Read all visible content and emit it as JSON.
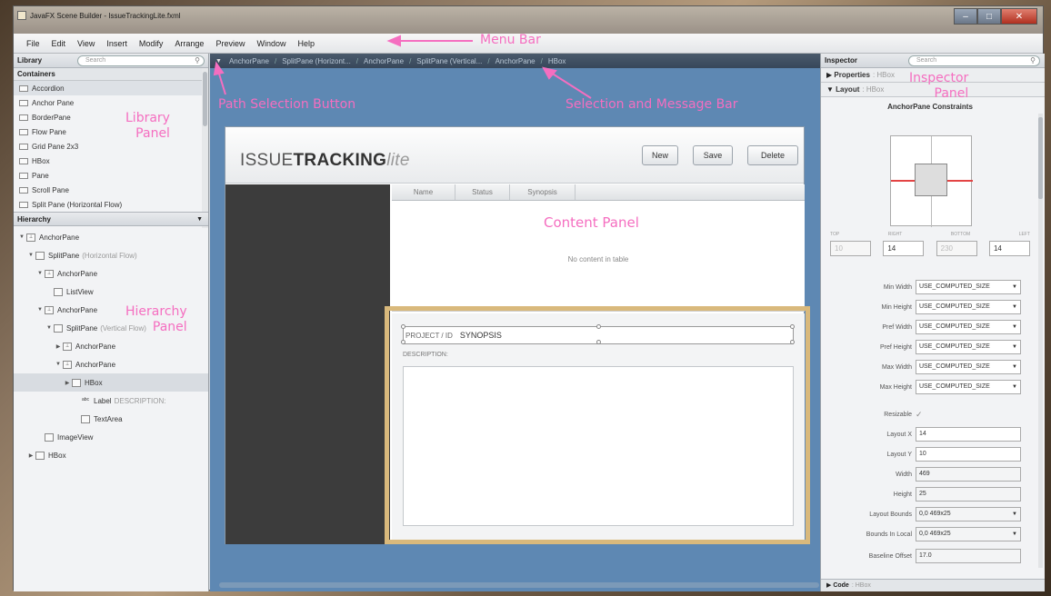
{
  "window": {
    "title": "JavaFX Scene Builder - IssueTrackingLite.fxml",
    "buttons": [
      "–",
      "□",
      "✕"
    ]
  },
  "menubar": [
    "File",
    "Edit",
    "View",
    "Insert",
    "Modify",
    "Arrange",
    "Preview",
    "Window",
    "Help"
  ],
  "library": {
    "title": "Library",
    "search_placeholder": "Search",
    "section": "Containers",
    "items": [
      {
        "label": "Accordion",
        "selected": true
      },
      {
        "label": "Anchor Pane"
      },
      {
        "label": "BorderPane"
      },
      {
        "label": "Flow Pane"
      },
      {
        "label": "Grid Pane 2x3"
      },
      {
        "label": "HBox"
      },
      {
        "label": "Pane"
      },
      {
        "label": "Scroll Pane"
      },
      {
        "label": "Split Pane (Horizontal Flow)"
      }
    ]
  },
  "hierarchy": {
    "title": "Hierarchy",
    "items": [
      {
        "label": "AnchorPane",
        "extra": ""
      },
      {
        "label": "SplitPane",
        "extra": "(Horizontal Flow)"
      },
      {
        "label": "AnchorPane",
        "extra": ""
      },
      {
        "label": "ListView",
        "extra": ""
      },
      {
        "label": "AnchorPane",
        "extra": ""
      },
      {
        "label": "SplitPane",
        "extra": "(Vertical Flow)"
      },
      {
        "label": "AnchorPane",
        "extra": ""
      },
      {
        "label": "AnchorPane",
        "extra": ""
      },
      {
        "label": "HBox",
        "extra": ""
      },
      {
        "label": "Label",
        "extra": "DESCRIPTION:"
      },
      {
        "label": "TextArea",
        "extra": ""
      },
      {
        "label": "ImageView",
        "extra": ""
      },
      {
        "label": "HBox",
        "extra": ""
      }
    ]
  },
  "pathbar": {
    "crumbs": [
      "AnchorPane",
      "SplitPane (Horizont...",
      "AnchorPane",
      "SplitPane (Vertical...",
      "AnchorPane",
      "HBox"
    ]
  },
  "content": {
    "logo_main": "ISSUE",
    "logo_bold": "TRACKING",
    "logo_lite": "lite",
    "buttons": {
      "new": "New",
      "save": "Save",
      "delete": "Delete"
    },
    "table_columns": [
      "Name",
      "Status",
      "Synopsis"
    ],
    "empty_message": "No content in table",
    "project_label": "PROJECT / ID",
    "synopsis": "SYNOPSIS",
    "description_label": "DESCRIPTION:"
  },
  "inspector": {
    "title": "Inspector",
    "search_placeholder": "Search",
    "properties": {
      "label": "Properties",
      "node": ": HBox"
    },
    "layout": {
      "label": "Layout",
      "node": ": HBox"
    },
    "code": {
      "label": "Code",
      "node": ": HBox"
    },
    "constraints_title": "AnchorPane Constraints",
    "constraint_labels": [
      "TOP",
      "RIGHT",
      "BOTTOM",
      "LEFT"
    ],
    "constraint_values": [
      "10",
      "14",
      "230",
      "14"
    ],
    "rows": [
      {
        "label": "Min Width",
        "value": "USE_COMPUTED_SIZE"
      },
      {
        "label": "Min Height",
        "value": "USE_COMPUTED_SIZE"
      },
      {
        "label": "Pref Width",
        "value": "USE_COMPUTED_SIZE"
      },
      {
        "label": "Pref Height",
        "value": "USE_COMPUTED_SIZE"
      },
      {
        "label": "Max Width",
        "value": "USE_COMPUTED_SIZE"
      },
      {
        "label": "Max Height",
        "value": "USE_COMPUTED_SIZE"
      },
      {
        "label": "Resizable",
        "value": "✓"
      },
      {
        "label": "Layout X",
        "value": "14"
      },
      {
        "label": "Layout Y",
        "value": "10"
      },
      {
        "label": "Width",
        "value": "469"
      },
      {
        "label": "Height",
        "value": "25"
      },
      {
        "label": "Layout Bounds",
        "value": "0,0 469x25"
      },
      {
        "label": "Bounds In Local",
        "value": "0,0 469x25"
      },
      {
        "label": "Baseline Offset",
        "value": "17.0"
      }
    ]
  },
  "annotations": {
    "menu_bar": "Menu Bar",
    "library_panel": "Library\nPanel",
    "hierarchy_panel": "Hierarchy\nPanel",
    "path_button": "Path Selection Button",
    "selection_bar": "Selection and Message Bar",
    "inspector_panel": "Inspector\nPanel",
    "content_panel": "Content Panel"
  },
  "colors": {
    "annotation_pink": "#f56ec0",
    "annotation_yellow": "#ffd83a",
    "canvas_blue": "#5e88b3",
    "selection_frame": "#d9b97c"
  }
}
